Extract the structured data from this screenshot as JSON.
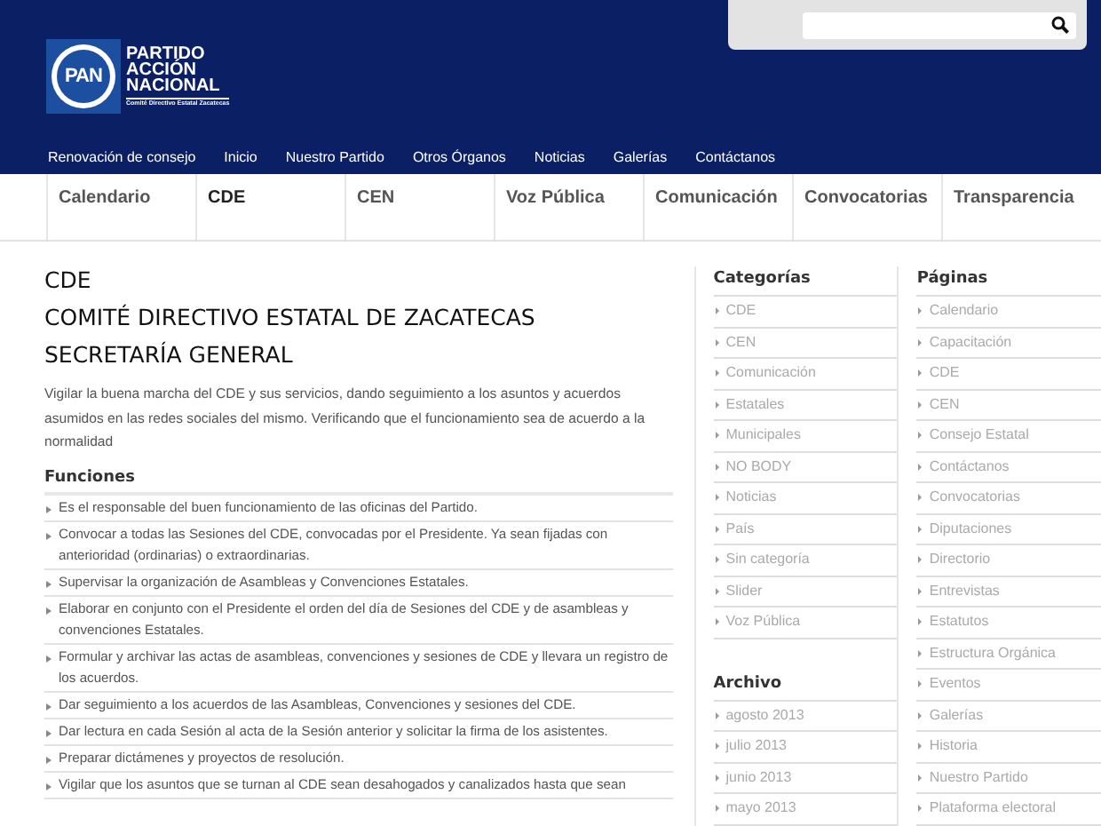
{
  "header": {
    "logo_mark": "PAN",
    "logo_lines": [
      "PARTIDO",
      "ACCIÓN",
      "NACIONAL"
    ],
    "logo_subtitle": "Comité Directivo Estatal Zacatecas"
  },
  "top_nav": [
    "Renovación de consejo",
    "Inicio",
    "Nuestro Partido",
    "Otros Órganos",
    "Noticias",
    "Galerías",
    "Contáctanos"
  ],
  "tabs": [
    {
      "label": "Calendario",
      "selected": false
    },
    {
      "label": "CDE",
      "selected": true
    },
    {
      "label": "CEN",
      "selected": false
    },
    {
      "label": "Voz Pública",
      "selected": false
    },
    {
      "label": "Comunicación",
      "selected": false
    },
    {
      "label": "Convocatorias",
      "selected": false
    },
    {
      "label": "Transparencia",
      "selected": false
    }
  ],
  "main": {
    "titles": [
      "CDE",
      "COMITÉ DIRECTIVO ESTATAL DE ZACATECAS",
      "SECRETARÍA GENERAL"
    ],
    "intro": "Vigilar la buena marcha del CDE y sus servicios, dando seguimiento a los asuntos y acuerdos asumidos en las redes sociales del mismo. Verificando que el funcionamiento sea de acuerdo a la normalidad",
    "section_title": "Funciones",
    "functions": [
      "Es el responsable del buen funcionamiento de las oficinas del Partido.",
      "Convocar a todas las Sesiones del CDE, convocadas por el Presidente. Ya sean fijadas con anterioridad (ordinarias) o extraordinarias.",
      "Supervisar la organización de Asambleas y Convenciones Estatales.",
      "Elaborar en conjunto con el Presidente el orden del día de Sesiones del CDE y de asambleas y convenciones Estatales.",
      "Formular y archivar las actas de asambleas, convenciones y sesiones de CDE y llevara un registro de los acuerdos.",
      "Dar seguimiento a los acuerdos de las Asambleas, Convenciones y sesiones del CDE.",
      "Dar lectura en cada Sesión al acta de la Sesión anterior y solicitar la firma de los asistentes.",
      "Preparar dictámenes y proyectos de resolución.",
      "Vigilar que los asuntos que se turnan al CDE sean desahogados y canalizados hasta que sean"
    ]
  },
  "sidebar_left": [
    {
      "title": "Categorías",
      "items": [
        "CDE",
        "CEN",
        "Comunicación",
        "Estatales",
        "Municipales",
        "NO BODY",
        "Noticias",
        "País",
        "Sin categoría",
        "Slider",
        "Voz Pública"
      ]
    },
    {
      "title": "Archivo",
      "items": [
        "agosto 2013",
        "julio 2013",
        "junio 2013",
        "mayo 2013"
      ]
    }
  ],
  "sidebar_right": [
    {
      "title": "Páginas",
      "items": [
        "Calendario",
        "Capacitación",
        "CDE",
        "CEN",
        "Consejo Estatal",
        "Contáctanos",
        "Convocatorias",
        "Diputaciones",
        "Directorio",
        "Entrevistas",
        "Estatutos",
        "Estructura Orgánica",
        "Eventos",
        "Galerías",
        "Historia",
        "Nuestro Partido",
        "Plataforma electoral"
      ]
    }
  ]
}
